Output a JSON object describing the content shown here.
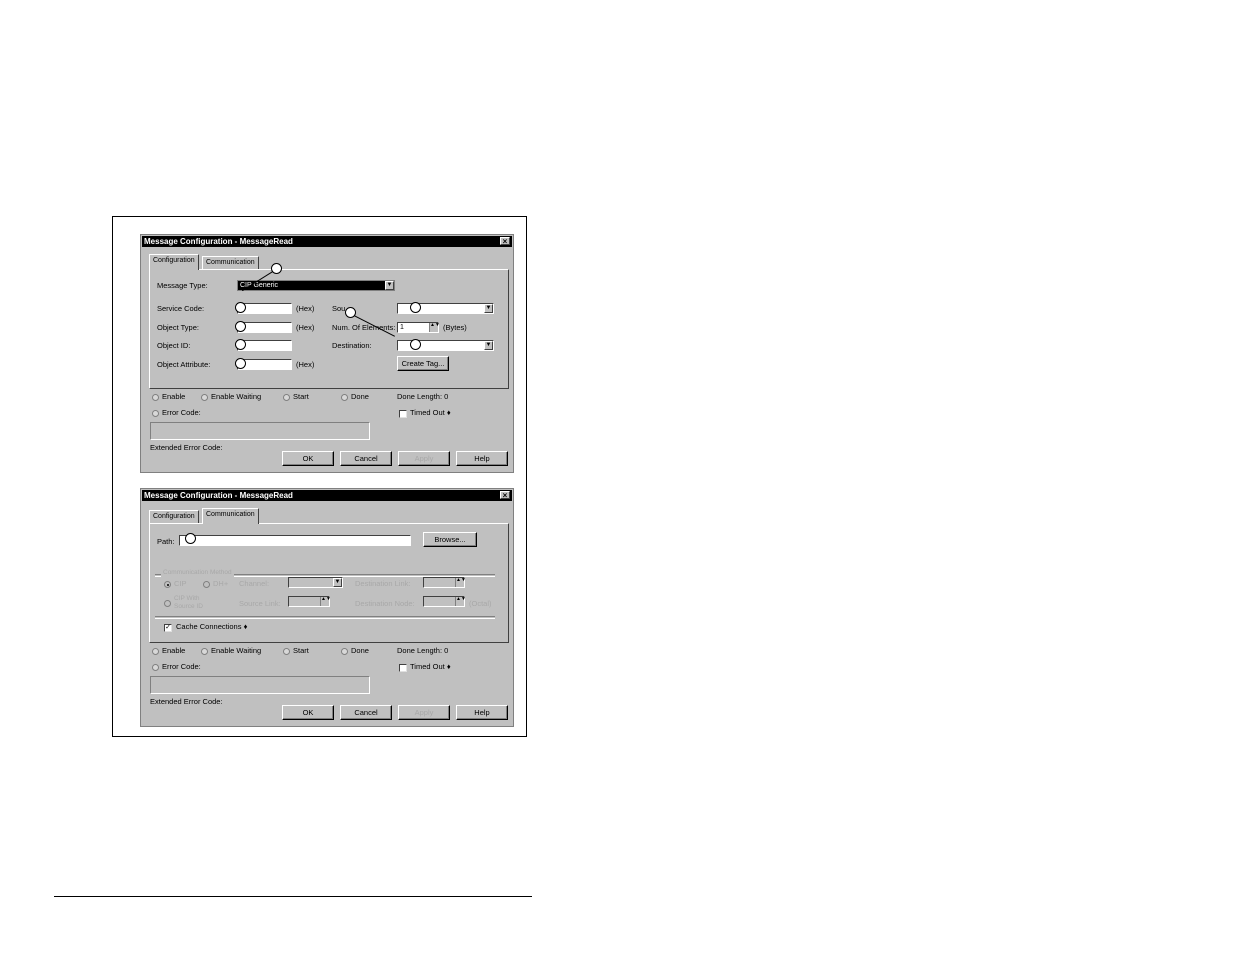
{
  "dialog_title": "Message Configuration - MessageRead",
  "close_glyph": "×",
  "tabs": {
    "configuration": "Configuration",
    "communication": "Communication"
  },
  "config": {
    "message_type_label": "Message Type:",
    "message_type_value": "CIP Generic",
    "service_code_label": "Service Code:",
    "object_type_label": "Object Type:",
    "object_id_label": "Object ID:",
    "object_attribute_label": "Object Attribute:",
    "hex_label": "(Hex)",
    "source_label": "Sou",
    "num_elements_label": "Num. Of Elements:",
    "num_elements_value": "1",
    "bytes_label": "(Bytes)",
    "destination_label": "Destination:",
    "create_tag_label": "Create Tag..."
  },
  "comm": {
    "path_label": "Path:",
    "browse_label": "Browse...",
    "comm_method_label": "Communication Method",
    "cip_label": "CIP",
    "dh_label": "DH+",
    "channel_label": "Channel:",
    "dest_link_label": "Destination Link:",
    "cip_source_label_1": "CIP With",
    "cip_source_label_2": "Source ID",
    "source_link_label": "Source Link:",
    "dest_node_label": "Destination Node:",
    "octal_label": "(Octal)",
    "cache_label": "Cache Connections",
    "cache_check": "✓",
    "arrow": "♦"
  },
  "status": {
    "enable": "Enable",
    "enable_waiting": "Enable Waiting",
    "start": "Start",
    "done": "Done",
    "done_length": "Done Length: 0",
    "error_code": "Error Code:",
    "timed_out": "Timed Out",
    "timed_out_arrow": "♦",
    "extended_error": "Extended Error Code:"
  },
  "buttons": {
    "ok": "OK",
    "cancel": "Cancel",
    "apply": "Apply",
    "help": "Help"
  },
  "glyphs": {
    "dropdown": "▼",
    "spin": "▲▼"
  }
}
